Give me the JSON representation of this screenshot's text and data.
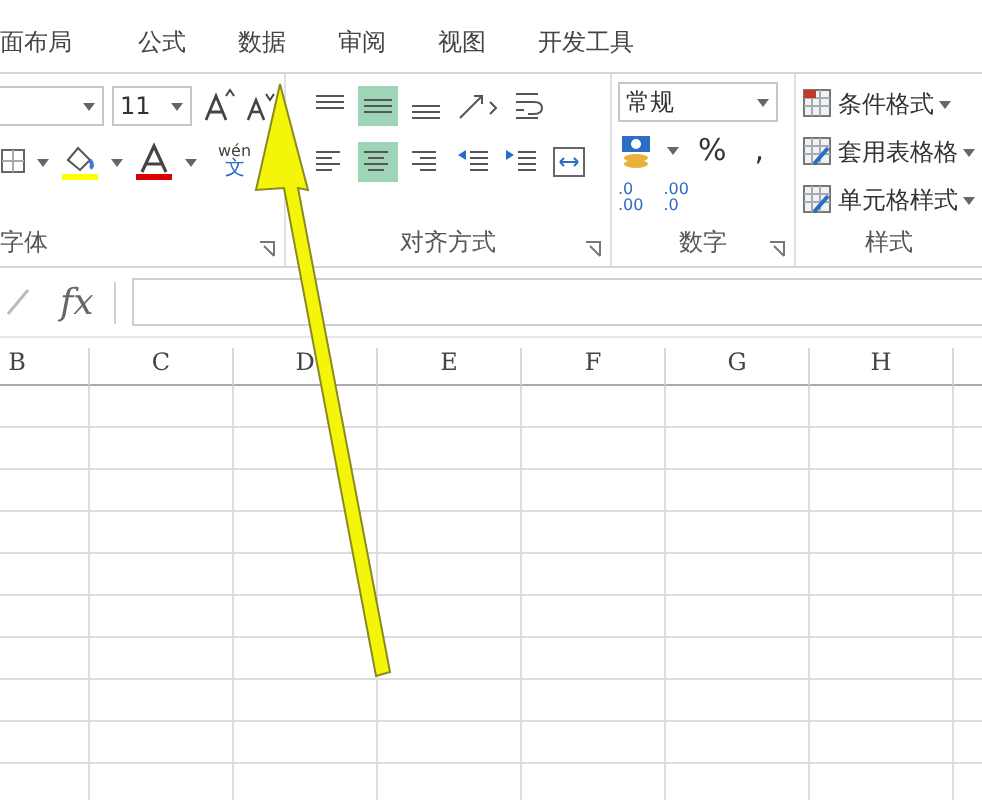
{
  "tabs": [
    {
      "label": "面布局",
      "selected": false
    },
    {
      "label": "公式",
      "selected": false
    },
    {
      "label": "数据",
      "selected": false
    },
    {
      "label": "审阅",
      "selected": false
    },
    {
      "label": "视图",
      "selected": false
    },
    {
      "label": "开发工具",
      "selected": false
    }
  ],
  "font_group": {
    "font_size": "11",
    "phonetic_top": "wén",
    "phonetic_bottom": "文",
    "label": "字体"
  },
  "alignment_group": {
    "label": "对齐方式",
    "top_row": [
      {
        "kind": "top",
        "selected": false
      },
      {
        "kind": "middle",
        "selected": true
      },
      {
        "kind": "bottom",
        "selected": false
      }
    ],
    "bottom_row": [
      {
        "kind": "left",
        "selected": false
      },
      {
        "kind": "center",
        "selected": true
      },
      {
        "kind": "right",
        "selected": false
      },
      {
        "kind": "outdent",
        "selected": false
      },
      {
        "kind": "indent",
        "selected": false
      }
    ]
  },
  "number_group": {
    "format": "常规",
    "percent": "%",
    "comma": ",",
    "increase_decimal": [
      ".0",
      ".00"
    ],
    "decrease_decimal": [
      ".00",
      ".0"
    ],
    "label": "数字"
  },
  "styles_group": {
    "items": [
      "条件格式",
      "套用表格格",
      "单元格样式"
    ],
    "label": "样式"
  },
  "formula_bar": {
    "fx": "fx"
  },
  "columns": [
    "B",
    "C",
    "D",
    "E",
    "F",
    "G",
    "H"
  ]
}
